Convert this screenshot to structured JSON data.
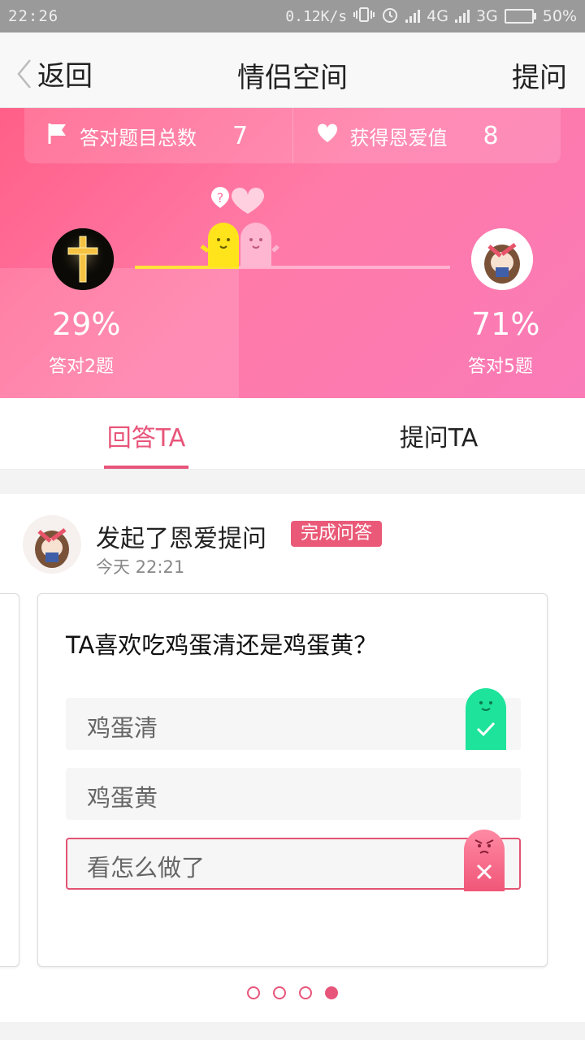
{
  "status": {
    "time": "22:26",
    "speed": "0.12K/s",
    "network1": "4G",
    "network2": "3G",
    "battery": "50%",
    "battery_level": 0.5
  },
  "nav": {
    "back_label": "返回",
    "title": "情侣空间",
    "ask_label": "提问"
  },
  "stats": {
    "total_label": "答对题目总数",
    "total_value": "7",
    "love_label": "获得恩爱值",
    "love_value": "8"
  },
  "compare": {
    "left": {
      "percent": "29%",
      "answered": "答对2题",
      "share": 0.29
    },
    "right": {
      "percent": "71%",
      "answered": "答对5题",
      "share": 0.71
    }
  },
  "tabs": [
    {
      "label": "回答TA",
      "active": true
    },
    {
      "label": "提问TA",
      "active": false
    }
  ],
  "post": {
    "action": "发起了恩爱提问",
    "badge": "完成问答",
    "time": "今天 22:21",
    "question": "TA喜欢吃鸡蛋清还是鸡蛋黄？",
    "options": [
      {
        "text": "鸡蛋清",
        "state": "correct"
      },
      {
        "text": "鸡蛋黄",
        "state": "none"
      },
      {
        "text": "看怎么做了",
        "state": "wrong"
      }
    ]
  },
  "pager": {
    "count": 4,
    "active": 4
  },
  "colors": {
    "accent": "#e8557a",
    "correct": "#1ee39a",
    "hero": "#ff6f9e"
  }
}
